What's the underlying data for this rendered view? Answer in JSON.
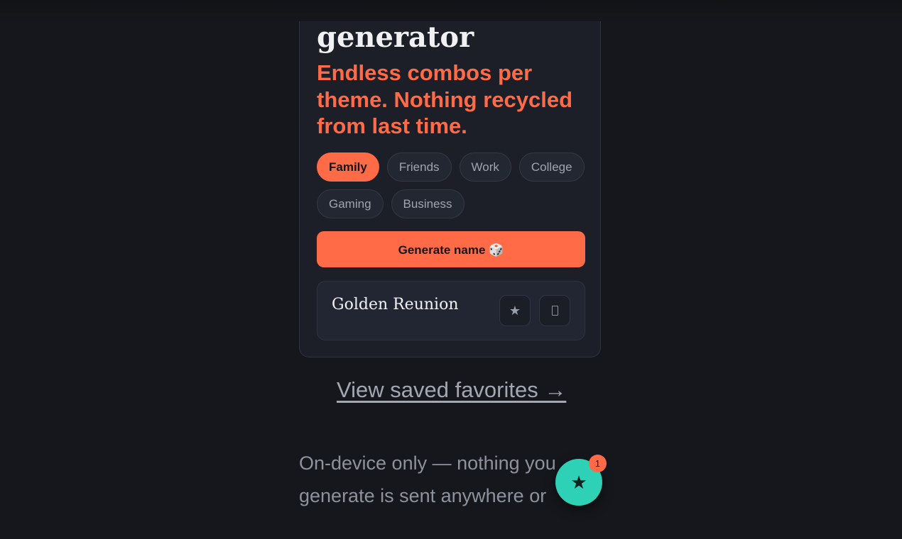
{
  "app": {
    "title_visible": "generator",
    "tagline": "Endless combos per theme. Nothing recycled from last time."
  },
  "themes": {
    "chips": [
      {
        "label": "Family",
        "active": true
      },
      {
        "label": "Friends",
        "active": false
      },
      {
        "label": "Work",
        "active": false
      },
      {
        "label": "College",
        "active": false
      },
      {
        "label": "Gaming",
        "active": false
      },
      {
        "label": "Business",
        "active": false
      }
    ]
  },
  "generate": {
    "label": "Generate name 🎲"
  },
  "result": {
    "name": "Golden Reunion",
    "favorite_icon": "★",
    "copy_icon": "copy-icon"
  },
  "favorites_link": {
    "label": "View saved favorites →"
  },
  "privacy": {
    "text": "On-device only — nothing you generate is sent anywhere or"
  },
  "fab": {
    "icon": "★",
    "badge_count": "1"
  },
  "colors": {
    "background": "#15171c",
    "card": "#1c1f27",
    "accent": "#ff6a47",
    "fab": "#2fd1b6",
    "muted_text": "#8e929c"
  }
}
